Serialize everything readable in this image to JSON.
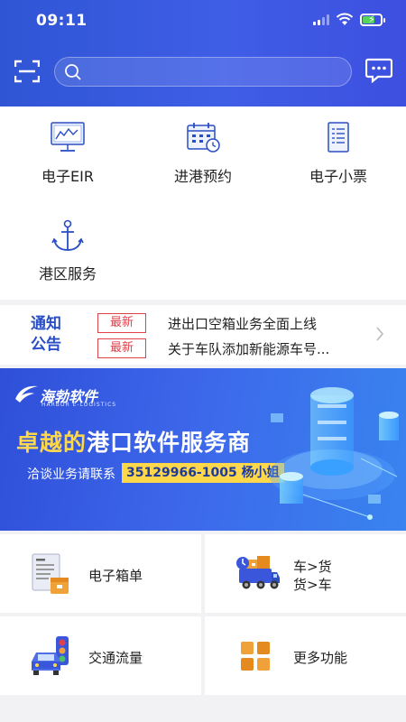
{
  "status_bar": {
    "time": "09:11"
  },
  "search": {
    "placeholder": ""
  },
  "quick_menu": [
    {
      "label": "电子EIR",
      "icon": "monitor-chart-icon"
    },
    {
      "label": "进港预约",
      "icon": "calendar-clock-icon"
    },
    {
      "label": "电子小票",
      "icon": "receipt-icon"
    },
    {
      "label": "港区服务",
      "icon": "anchor-icon"
    }
  ],
  "notice": {
    "title_line1": "通知",
    "title_line2": "公告",
    "items": [
      {
        "tag": "最新",
        "text": "进出口空箱业务全面上线"
      },
      {
        "tag": "最新",
        "text": "关于车队添加新能源车号..."
      }
    ]
  },
  "banner": {
    "logo_text": "海勃软件",
    "logo_sub": "HARBOR E-LOGISTICS",
    "slogan_highlight": "卓越的",
    "slogan_rest": "港口软件服务商",
    "contact_label": "洽谈业务请联系",
    "contact_phone": "35129966-1005 杨小姐"
  },
  "features": [
    {
      "line1": "电子箱单",
      "line2": "",
      "icon": "document-box-icon"
    },
    {
      "line1": "车>货",
      "line2": "货>车",
      "icon": "truck-cargo-icon"
    },
    {
      "line1": "交通流量",
      "line2": "",
      "icon": "traffic-light-car-icon"
    },
    {
      "line1": "更多功能",
      "line2": "",
      "icon": "grid-more-icon"
    }
  ],
  "colors": {
    "header": "#3a57dc",
    "accent": "#2a4ec4",
    "tag_red": "#e0424b",
    "highlight": "#ffd74a"
  }
}
